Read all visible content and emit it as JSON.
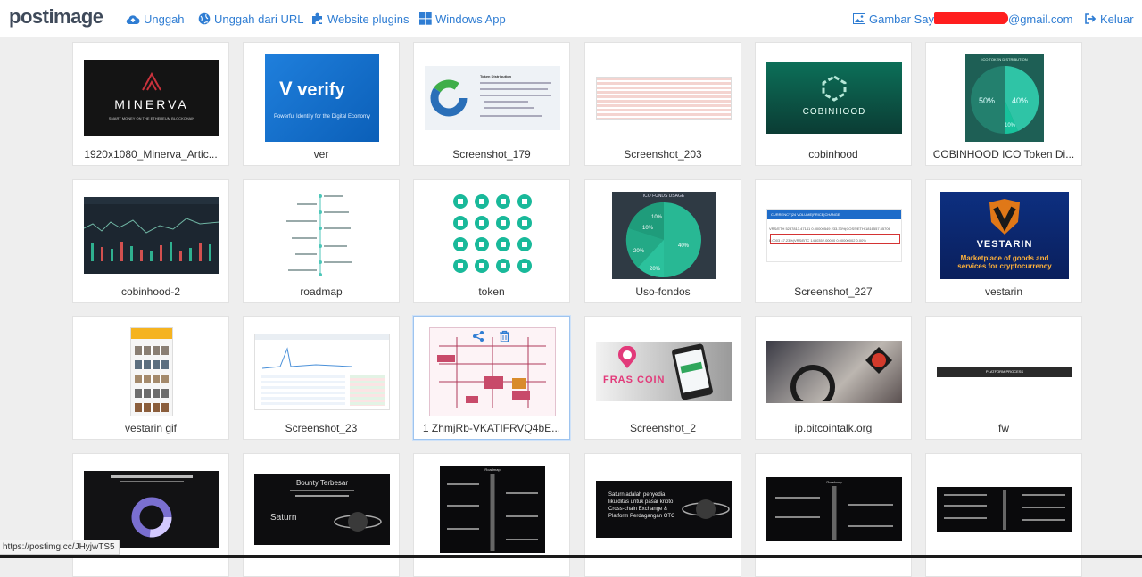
{
  "header": {
    "logo_text": "postimage",
    "nav": [
      {
        "label": "Unggah",
        "icon": "cloud-upload-icon"
      },
      {
        "label": "Unggah dari URL",
        "icon": "globe-icon"
      },
      {
        "label": "Website plugins",
        "icon": "puzzle-icon"
      },
      {
        "label": "Windows App",
        "icon": "windows-icon"
      }
    ],
    "my_images_label": "Gambar Saya",
    "email_visible": "@gmail.com",
    "logout_label": "Keluar",
    "link_color": "#2f7dd3"
  },
  "gallery": {
    "items": [
      {
        "caption": "1920x1080_Minerva_Artic...",
        "thumb_text": "MINERVA",
        "thumb_sub": "SMART MONEY ON THE ETHEREUM BLOCKCHAIN"
      },
      {
        "caption": "ver",
        "thumb_text": "verify",
        "thumb_sub": "Powerful Identity for the Digital Economy"
      },
      {
        "caption": "Screenshot_179",
        "thumb_text": "Token Distribution",
        "thumb_sub": ""
      },
      {
        "caption": "Screenshot_203",
        "thumb_text": "",
        "thumb_sub": ""
      },
      {
        "caption": "cobinhood",
        "thumb_text": "COBINHOOD",
        "thumb_sub": ""
      },
      {
        "caption": "COBINHOOD ICO Token Di...",
        "thumb_text": "ICO TOKEN DISTRIBUTION",
        "thumb_sub": "50%|40%|10%"
      },
      {
        "caption": "cobinhood-2",
        "thumb_text": "",
        "thumb_sub": ""
      },
      {
        "caption": "roadmap",
        "thumb_text": "",
        "thumb_sub": ""
      },
      {
        "caption": "token",
        "thumb_text": "",
        "thumb_sub": ""
      },
      {
        "caption": "Uso-fondos",
        "thumb_text": "ICO FUNDS USAGE",
        "thumb_sub": "10%|10%|20%|20%|40%"
      },
      {
        "caption": "Screenshot_227",
        "thumb_text": "CURRENCY|24 VOLUME|PRICE|CHANGE",
        "thumb_sub": "VRS/ETH 5287813.47141 0.00000549 233.33%|COSS/ETH 1816557.55706 0.0003 47.23%|VRS/BTC 1450352.00000 0.00000002 0.00%"
      },
      {
        "caption": "vestarin",
        "thumb_text": "VESTARIN",
        "thumb_sub": "Marketplace of goods and services for cryptocurrency"
      },
      {
        "caption": "vestarin gif",
        "thumb_text": "",
        "thumb_sub": ""
      },
      {
        "caption": "Screenshot_23",
        "thumb_text": "",
        "thumb_sub": ""
      },
      {
        "caption": "1 ZhmjRb-VKATIFRVQ4bE...",
        "thumb_text": "",
        "thumb_sub": ""
      },
      {
        "caption": "Screenshot_2",
        "thumb_text": "FRAS COIN",
        "thumb_sub": ""
      },
      {
        "caption": "ip.bitcointalk.org",
        "thumb_text": "",
        "thumb_sub": ""
      },
      {
        "caption": "fw",
        "thumb_text": "PLATFORM PROCESS",
        "thumb_sub": ""
      },
      {
        "caption": "",
        "thumb_text": "",
        "thumb_sub": ""
      },
      {
        "caption": "",
        "thumb_text": "Bounty Terbesar",
        "thumb_sub": "Saturn"
      },
      {
        "caption": "",
        "thumb_text": "Roadmap",
        "thumb_sub": ""
      },
      {
        "caption": "",
        "thumb_text": "Saturn adalah penyedia likuiditas untuk pasar kripto Cross-chain Exchange & Platform Perdagangan OTC",
        "thumb_sub": ""
      },
      {
        "caption": "",
        "thumb_text": "Roadmap",
        "thumb_sub": ""
      },
      {
        "caption": "",
        "thumb_text": "",
        "thumb_sub": ""
      }
    ],
    "active_index": 14,
    "active_actions": [
      {
        "icon": "share-icon"
      },
      {
        "icon": "trash-icon"
      }
    ]
  },
  "statusbar": {
    "url": "https://postimg.cc/JHyjwTS5"
  }
}
